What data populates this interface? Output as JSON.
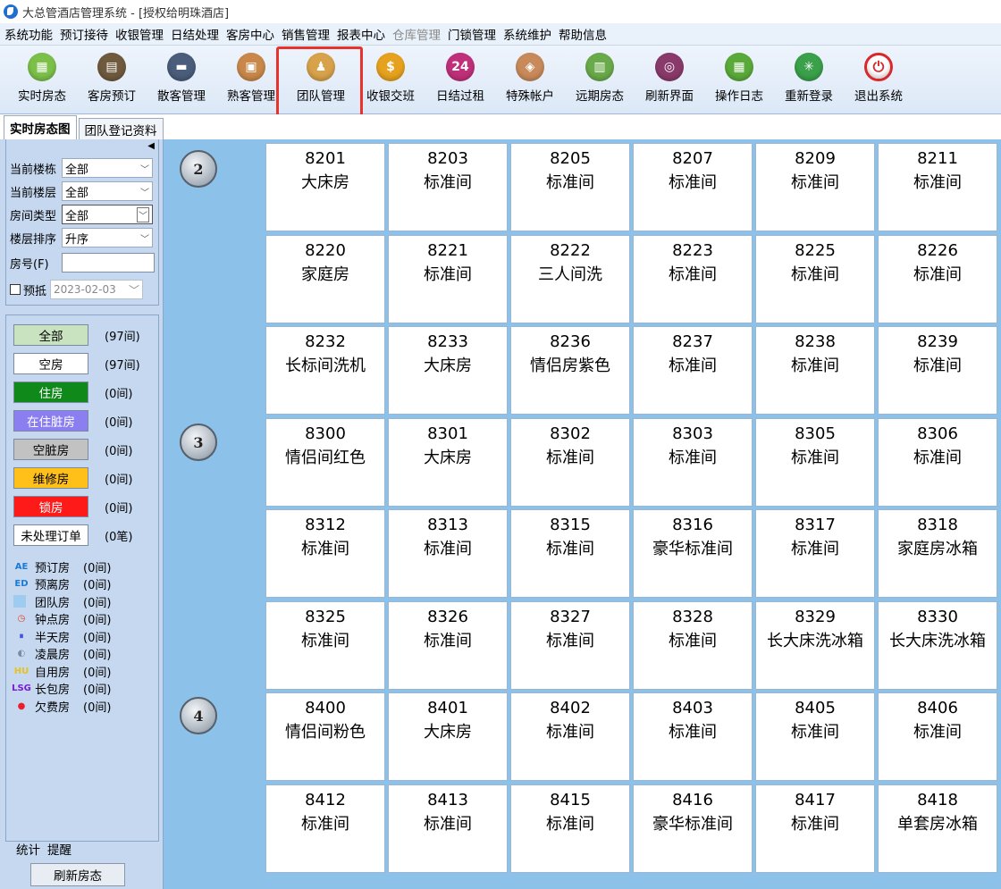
{
  "window": {
    "title": "大总管酒店管理系统 - [授权给明珠酒店]"
  },
  "menu": [
    "系统功能",
    "预订接待",
    "收银管理",
    "日结处理",
    "客房中心",
    "销售管理",
    "报表中心",
    "仓库管理",
    "门锁管理",
    "系统维护",
    "帮助信息"
  ],
  "menu_disabled_index": 7,
  "toolbar": [
    {
      "label": "实时房态",
      "icon": "grid-icon",
      "color": "#7cc04a"
    },
    {
      "label": "客房预订",
      "icon": "booking-icon",
      "color": "#6f5a3e"
    },
    {
      "label": "散客管理",
      "icon": "guest-icon",
      "color": "#4a5d7a"
    },
    {
      "label": "熟客管理",
      "icon": "vip-card-icon",
      "color": "#c9884a"
    },
    {
      "label": "团队管理",
      "icon": "team-icon",
      "color": "#d7a24a"
    },
    {
      "label": "收银交班",
      "icon": "cashier-icon",
      "color": "#e6a21e"
    },
    {
      "label": "日结过租",
      "icon": "24h-icon",
      "color": "#c0307a"
    },
    {
      "label": "特殊帐户",
      "icon": "tag-icon",
      "color": "#c88a5a"
    },
    {
      "label": "远期房态",
      "icon": "chart-icon",
      "color": "#6aaa4a"
    },
    {
      "label": "刷新界面",
      "icon": "refresh-icon",
      "color": "#8a3a6a"
    },
    {
      "label": "操作日志",
      "icon": "calendar-icon",
      "color": "#5aaa3a"
    },
    {
      "label": "重新登录",
      "icon": "relogin-icon",
      "color": "#3aa04a"
    },
    {
      "label": "退出系统",
      "icon": "power-icon",
      "color": "#d8282c"
    }
  ],
  "tabs": [
    "实时房态图",
    "团队登记资料"
  ],
  "filters": {
    "building": {
      "label": "当前楼栋",
      "value": "全部"
    },
    "floor": {
      "label": "当前楼层",
      "value": "全部"
    },
    "room_type": {
      "label": "房间类型",
      "value": "全部"
    },
    "sort": {
      "label": "楼层排序",
      "value": "升序"
    },
    "room_no": {
      "label": "房号(F)",
      "value": ""
    },
    "prepay": {
      "label": "预抵",
      "date": "2023-02-03"
    }
  },
  "status_buttons": [
    {
      "label": "全部",
      "count": "(97间)",
      "bg": "#c9e2c0",
      "fg": "#000"
    },
    {
      "label": "空房",
      "count": "(97间)",
      "bg": "#ffffff",
      "fg": "#000"
    },
    {
      "label": "住房",
      "count": "(0间)",
      "bg": "#0f8a1a",
      "fg": "#ffffff"
    },
    {
      "label": "在住脏房",
      "count": "(0间)",
      "bg": "#8a7ef0",
      "fg": "#ffffff"
    },
    {
      "label": "空脏房",
      "count": "(0间)",
      "bg": "#c2c2c2",
      "fg": "#000"
    },
    {
      "label": "维修房",
      "count": "(0间)",
      "bg": "#ffc01a",
      "fg": "#000"
    },
    {
      "label": "锁房",
      "count": "(0间)",
      "bg": "#ff1a1a",
      "fg": "#ffffff"
    },
    {
      "label": "未处理订单",
      "count": "(0笔)",
      "bg": "#ffffff",
      "fg": "#000"
    }
  ],
  "legend": [
    {
      "label": "预订房",
      "count": "(0间)",
      "icon": "AE",
      "color": "#1a7ad8"
    },
    {
      "label": "预离房",
      "count": "(0间)",
      "icon": "ED",
      "color": "#1a7ad8"
    },
    {
      "label": "团队房",
      "count": "(0间)",
      "icon": "",
      "color": "#9ecbf0"
    },
    {
      "label": "钟点房",
      "count": "(0间)",
      "icon": "◷",
      "color": "#e8402a"
    },
    {
      "label": "半天房",
      "count": "(0间)",
      "icon": "⏸",
      "color": "#3a4ad8"
    },
    {
      "label": "凌晨房",
      "count": "(0间)",
      "icon": "◐",
      "color": "#7a8aa0"
    },
    {
      "label": "自用房",
      "count": "(0间)",
      "icon": "HU",
      "color": "#e8c21a"
    },
    {
      "label": "长包房",
      "count": "(0间)",
      "icon": "LSG",
      "color": "#7a1ad8"
    },
    {
      "label": "欠费房",
      "count": "(0间)",
      "icon": "●",
      "color": "#e8202a"
    }
  ],
  "bottom_tabs": [
    "统计",
    "提醒"
  ],
  "refresh_button": "刷新房态",
  "floors": [
    "2",
    "3",
    "4"
  ],
  "rooms": [
    [
      [
        "8201",
        "大床房"
      ],
      [
        "8203",
        "标准间"
      ],
      [
        "8205",
        "标准间"
      ],
      [
        "8207",
        "标准间"
      ],
      [
        "8209",
        "标准间"
      ],
      [
        "8211",
        "标准间"
      ]
    ],
    [
      [
        "8220",
        "家庭房"
      ],
      [
        "8221",
        "标准间"
      ],
      [
        "8222",
        "三人间洗"
      ],
      [
        "8223",
        "标准间"
      ],
      [
        "8225",
        "标准间"
      ],
      [
        "8226",
        "标准间"
      ]
    ],
    [
      [
        "8232",
        "长标间洗机"
      ],
      [
        "8233",
        "大床房"
      ],
      [
        "8236",
        "情侣房紫色"
      ],
      [
        "8237",
        "标准间"
      ],
      [
        "8238",
        "标准间"
      ],
      [
        "8239",
        "标准间"
      ]
    ],
    [
      [
        "8300",
        "情侣间红色"
      ],
      [
        "8301",
        "大床房"
      ],
      [
        "8302",
        "标准间"
      ],
      [
        "8303",
        "标准间"
      ],
      [
        "8305",
        "标准间"
      ],
      [
        "8306",
        "标准间"
      ]
    ],
    [
      [
        "8312",
        "标准间"
      ],
      [
        "8313",
        "标准间"
      ],
      [
        "8315",
        "标准间"
      ],
      [
        "8316",
        "豪华标准间"
      ],
      [
        "8317",
        "标准间"
      ],
      [
        "8318",
        "家庭房冰箱"
      ]
    ],
    [
      [
        "8325",
        "标准间"
      ],
      [
        "8326",
        "标准间"
      ],
      [
        "8327",
        "标准间"
      ],
      [
        "8328",
        "标准间"
      ],
      [
        "8329",
        "长大床洗冰箱"
      ],
      [
        "8330",
        "长大床洗冰箱"
      ]
    ],
    [
      [
        "8400",
        "情侣间粉色"
      ],
      [
        "8401",
        "大床房"
      ],
      [
        "8402",
        "标准间"
      ],
      [
        "8403",
        "标准间"
      ],
      [
        "8405",
        "标准间"
      ],
      [
        "8406",
        "标准间"
      ]
    ],
    [
      [
        "8412",
        "标准间"
      ],
      [
        "8413",
        "标准间"
      ],
      [
        "8415",
        "标准间"
      ],
      [
        "8416",
        "豪华标准间"
      ],
      [
        "8417",
        "标准间"
      ],
      [
        "8418",
        "单套房冰箱"
      ]
    ]
  ]
}
